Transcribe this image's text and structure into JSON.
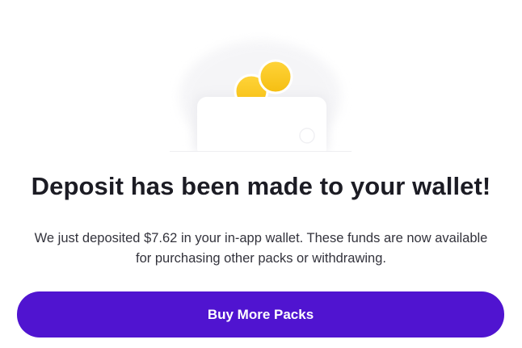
{
  "illustration": {
    "icon": "wallet-with-coins-icon",
    "coin_color": "#f9c81e",
    "wallet_color": "#ffffff"
  },
  "dialog": {
    "title": "Deposit has been made to your wallet!",
    "message": "We just deposited $7.62 in your in-app wallet. These funds are now available for purchasing other packs or withdrawing."
  },
  "actions": {
    "buy_more_label": "Buy More Packs",
    "accent_color": "#5014d0"
  }
}
